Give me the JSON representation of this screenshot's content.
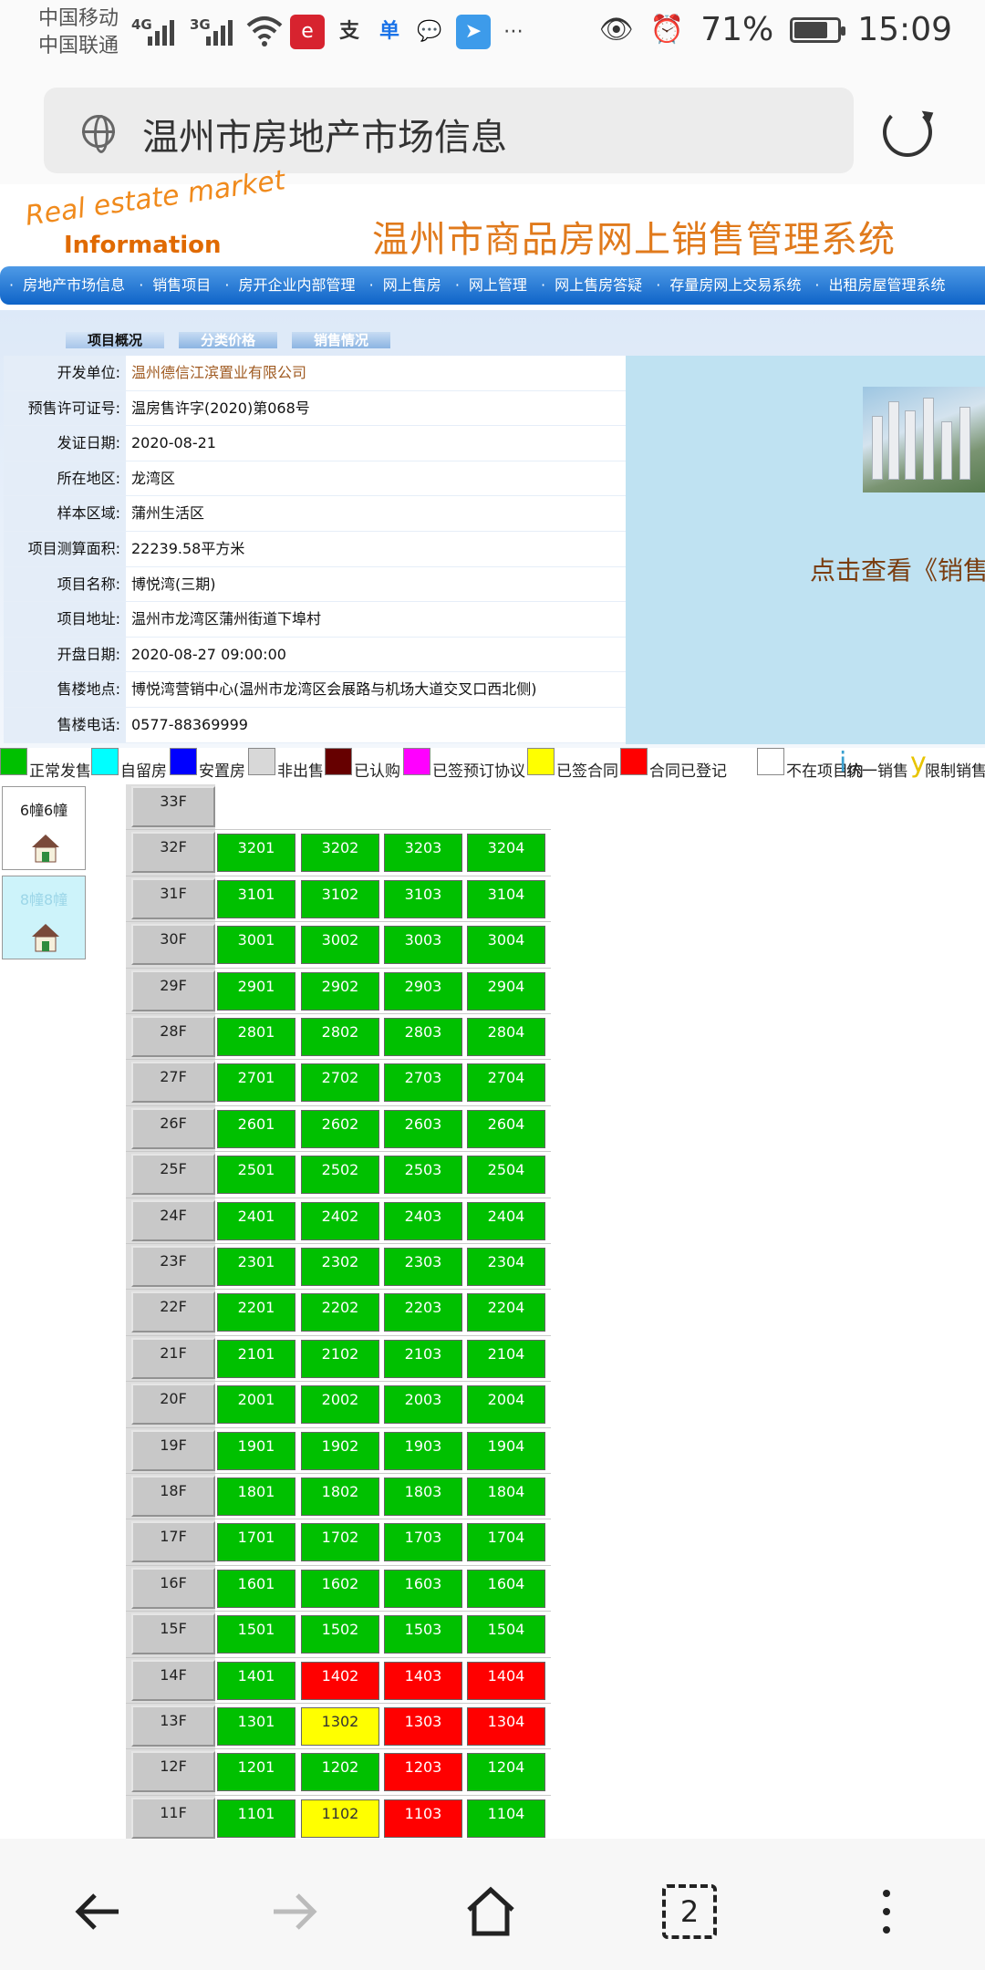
{
  "status_bar": {
    "carrier1": "中国移动",
    "carrier2": "中国联通",
    "net1": "4G",
    "net2": "3G",
    "battery": "71%",
    "time": "15:09"
  },
  "address_bar": {
    "title": "温州市房地产市场信息"
  },
  "site": {
    "logo_line1": "Real estate market",
    "logo_line2": "Information",
    "title": "温州市商品房网上销售管理系统",
    "nav": [
      "房地产市场信息",
      "销售项目",
      "房开企业内部管理",
      "网上售房",
      "网上管理",
      "网上售房答疑",
      "存量房网上交易系统",
      "出租房屋管理系统"
    ]
  },
  "tabs": [
    "项目概况",
    "分类价格",
    "销售情况"
  ],
  "project": [
    {
      "label": "开发单位:",
      "value": "温州德信江滨置业有限公司"
    },
    {
      "label": "预售许可证号:",
      "value": "温房售许字(2020)第068号"
    },
    {
      "label": "发证日期:",
      "value": "2020-08-21"
    },
    {
      "label": "所在地区:",
      "value": "龙湾区"
    },
    {
      "label": "样本区域:",
      "value": "蒲州生活区"
    },
    {
      "label": "项目测算面积:",
      "value": "22239.58平方米"
    },
    {
      "label": "项目名称:",
      "value": "博悦湾(三期)"
    },
    {
      "label": "项目地址:",
      "value": "温州市龙湾区蒲州街道下埠村"
    },
    {
      "label": "开盘日期:",
      "value": "2020-08-27 09:00:00"
    },
    {
      "label": "售楼地点:",
      "value": "博悦湾营销中心(温州市龙湾区会展路与机场大道交叉口西北侧)"
    },
    {
      "label": "售楼电话:",
      "value": "0577-88369999"
    }
  ],
  "side_link": "点击查看《销售",
  "legend": [
    {
      "label": "正常发售",
      "color": "#00c000"
    },
    {
      "label": "自留房",
      "color": "#00ffff"
    },
    {
      "label": "安置房",
      "color": "#0000ff"
    },
    {
      "label": "非出售",
      "color": "#d8d8d8"
    },
    {
      "label": "已认购",
      "color": "#660000"
    },
    {
      "label": "已签预订协议",
      "color": "#ff00ff"
    },
    {
      "label": "已签合同",
      "color": "#ffff00"
    },
    {
      "label": "合同已登记",
      "color": "#ff0000"
    },
    {
      "label": "不在项目内",
      "color": "#ffffff"
    },
    {
      "label": "统一销售",
      "glyph": "i"
    },
    {
      "label": "限制销售",
      "glyph": "y"
    }
  ],
  "buildings": [
    {
      "label": "6幢6幢",
      "active": true
    },
    {
      "label": "8幢8幢",
      "active": false
    }
  ],
  "floors": [
    {
      "floor": "33F",
      "units": []
    },
    {
      "floor": "32F",
      "units": [
        [
          "3201",
          "g"
        ],
        [
          "3202",
          "g"
        ],
        [
          "3203",
          "g"
        ],
        [
          "3204",
          "g"
        ]
      ]
    },
    {
      "floor": "31F",
      "units": [
        [
          "3101",
          "g"
        ],
        [
          "3102",
          "g"
        ],
        [
          "3103",
          "g"
        ],
        [
          "3104",
          "g"
        ]
      ]
    },
    {
      "floor": "30F",
      "units": [
        [
          "3001",
          "g"
        ],
        [
          "3002",
          "g"
        ],
        [
          "3003",
          "g"
        ],
        [
          "3004",
          "g"
        ]
      ]
    },
    {
      "floor": "29F",
      "units": [
        [
          "2901",
          "g"
        ],
        [
          "2902",
          "g"
        ],
        [
          "2903",
          "g"
        ],
        [
          "2904",
          "g"
        ]
      ]
    },
    {
      "floor": "28F",
      "units": [
        [
          "2801",
          "g"
        ],
        [
          "2802",
          "g"
        ],
        [
          "2803",
          "g"
        ],
        [
          "2804",
          "g"
        ]
      ]
    },
    {
      "floor": "27F",
      "units": [
        [
          "2701",
          "g"
        ],
        [
          "2702",
          "g"
        ],
        [
          "2703",
          "g"
        ],
        [
          "2704",
          "g"
        ]
      ]
    },
    {
      "floor": "26F",
      "units": [
        [
          "2601",
          "g"
        ],
        [
          "2602",
          "g"
        ],
        [
          "2603",
          "g"
        ],
        [
          "2604",
          "g"
        ]
      ]
    },
    {
      "floor": "25F",
      "units": [
        [
          "2501",
          "g"
        ],
        [
          "2502",
          "g"
        ],
        [
          "2503",
          "g"
        ],
        [
          "2504",
          "g"
        ]
      ]
    },
    {
      "floor": "24F",
      "units": [
        [
          "2401",
          "g"
        ],
        [
          "2402",
          "g"
        ],
        [
          "2403",
          "g"
        ],
        [
          "2404",
          "g"
        ]
      ]
    },
    {
      "floor": "23F",
      "units": [
        [
          "2301",
          "g"
        ],
        [
          "2302",
          "g"
        ],
        [
          "2303",
          "g"
        ],
        [
          "2304",
          "g"
        ]
      ]
    },
    {
      "floor": "22F",
      "units": [
        [
          "2201",
          "g"
        ],
        [
          "2202",
          "g"
        ],
        [
          "2203",
          "g"
        ],
        [
          "2204",
          "g"
        ]
      ]
    },
    {
      "floor": "21F",
      "units": [
        [
          "2101",
          "g"
        ],
        [
          "2102",
          "g"
        ],
        [
          "2103",
          "g"
        ],
        [
          "2104",
          "g"
        ]
      ]
    },
    {
      "floor": "20F",
      "units": [
        [
          "2001",
          "g"
        ],
        [
          "2002",
          "g"
        ],
        [
          "2003",
          "g"
        ],
        [
          "2004",
          "g"
        ]
      ]
    },
    {
      "floor": "19F",
      "units": [
        [
          "1901",
          "g"
        ],
        [
          "1902",
          "g"
        ],
        [
          "1903",
          "g"
        ],
        [
          "1904",
          "g"
        ]
      ]
    },
    {
      "floor": "18F",
      "units": [
        [
          "1801",
          "g"
        ],
        [
          "1802",
          "g"
        ],
        [
          "1803",
          "g"
        ],
        [
          "1804",
          "g"
        ]
      ]
    },
    {
      "floor": "17F",
      "units": [
        [
          "1701",
          "g"
        ],
        [
          "1702",
          "g"
        ],
        [
          "1703",
          "g"
        ],
        [
          "1704",
          "g"
        ]
      ]
    },
    {
      "floor": "16F",
      "units": [
        [
          "1601",
          "g"
        ],
        [
          "1602",
          "g"
        ],
        [
          "1603",
          "g"
        ],
        [
          "1604",
          "g"
        ]
      ]
    },
    {
      "floor": "15F",
      "units": [
        [
          "1501",
          "g"
        ],
        [
          "1502",
          "g"
        ],
        [
          "1503",
          "g"
        ],
        [
          "1504",
          "g"
        ]
      ]
    },
    {
      "floor": "14F",
      "units": [
        [
          "1401",
          "g"
        ],
        [
          "1402",
          "r"
        ],
        [
          "1403",
          "r"
        ],
        [
          "1404",
          "r"
        ]
      ]
    },
    {
      "floor": "13F",
      "units": [
        [
          "1301",
          "g"
        ],
        [
          "1302",
          "y"
        ],
        [
          "1303",
          "r"
        ],
        [
          "1304",
          "r"
        ]
      ]
    },
    {
      "floor": "12F",
      "units": [
        [
          "1201",
          "g"
        ],
        [
          "1202",
          "g"
        ],
        [
          "1203",
          "r"
        ],
        [
          "1204",
          "g"
        ]
      ]
    },
    {
      "floor": "11F",
      "units": [
        [
          "1101",
          "g"
        ],
        [
          "1102",
          "y"
        ],
        [
          "1103",
          "r"
        ],
        [
          "1104",
          "g"
        ]
      ]
    }
  ],
  "status_colors": {
    "g": "#00c000",
    "r": "#ff0000",
    "y": "#ffff00"
  },
  "bottom_nav": {
    "tabs_count": "2"
  }
}
